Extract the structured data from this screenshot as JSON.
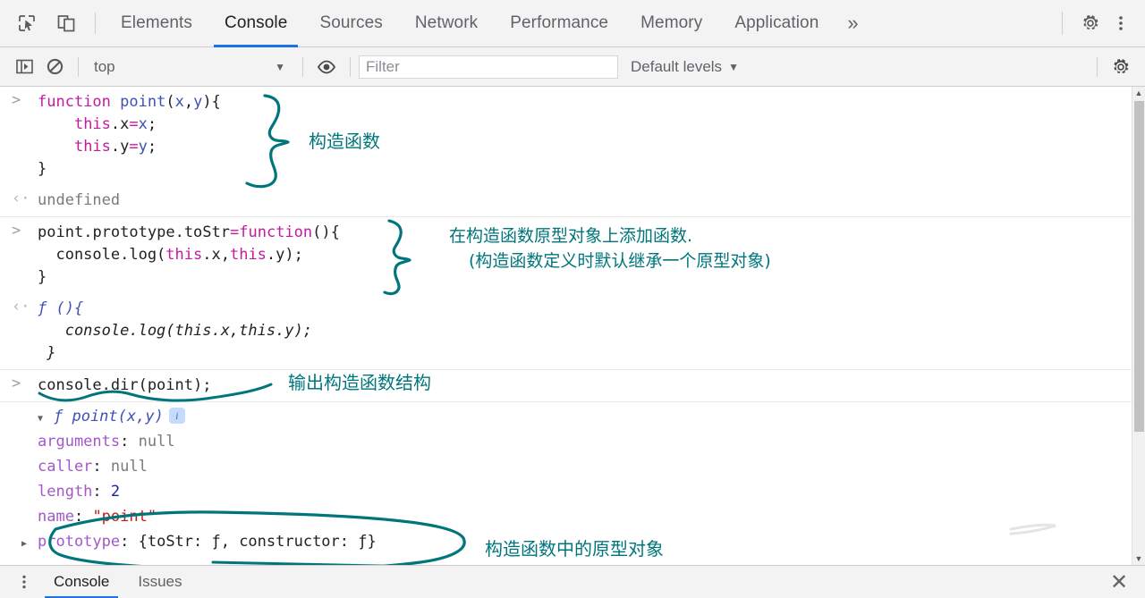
{
  "window": {
    "app": "Chrome DevTools"
  },
  "tabbar": {
    "icons": {
      "inspect": "inspect-element-icon",
      "device": "device-toolbar-icon",
      "more": "»",
      "settings": "gear-icon",
      "kebab": "more-options-icon"
    },
    "tabs": [
      {
        "label": "Elements",
        "active": false
      },
      {
        "label": "Console",
        "active": true
      },
      {
        "label": "Sources",
        "active": false
      },
      {
        "label": "Network",
        "active": false
      },
      {
        "label": "Performance",
        "active": false
      },
      {
        "label": "Memory",
        "active": false
      },
      {
        "label": "Application",
        "active": false
      }
    ]
  },
  "filterbar": {
    "sidebar_toggle": "show-console-sidebar-icon",
    "clear_console": "clear-console-icon",
    "context": "top",
    "context_caret": "▼",
    "eye": "live-expression-icon",
    "filter_placeholder": "Filter",
    "filter_value": "",
    "levels": "Default levels",
    "levels_caret": "▼",
    "settings": "gear-icon"
  },
  "console": {
    "prompt_glyph": ">",
    "response_glyph": "‹·",
    "entries": [
      {
        "id": "entry-function-point",
        "input_lines": [
          [
            {
              "t": "function ",
              "c": "kw"
            },
            {
              "t": "point",
              "c": "fn"
            },
            {
              "t": "(",
              "c": "plain"
            },
            {
              "t": "x",
              "c": "fn"
            },
            {
              "t": ",",
              "c": "plain"
            },
            {
              "t": "y",
              "c": "fn"
            },
            {
              "t": "){",
              "c": "plain"
            }
          ],
          [
            {
              "t": "    ",
              "c": "plain"
            },
            {
              "t": "this",
              "c": "kw"
            },
            {
              "t": ".",
              "c": "plain"
            },
            {
              "t": "x",
              "c": "plain"
            },
            {
              "t": "=",
              "c": "kw"
            },
            {
              "t": "x",
              "c": "fn"
            },
            {
              "t": ";",
              "c": "plain"
            }
          ],
          [
            {
              "t": "    ",
              "c": "plain"
            },
            {
              "t": "this",
              "c": "kw"
            },
            {
              "t": ".",
              "c": "plain"
            },
            {
              "t": "y",
              "c": "plain"
            },
            {
              "t": "=",
              "c": "kw"
            },
            {
              "t": "y",
              "c": "fn"
            },
            {
              "t": ";",
              "c": "plain"
            }
          ],
          [
            {
              "t": "}",
              "c": "plain"
            }
          ]
        ],
        "result": "undefined"
      },
      {
        "id": "entry-prototype-tostr",
        "input_lines": [
          [
            {
              "t": "point",
              "c": "plain"
            },
            {
              "t": ".",
              "c": "plain"
            },
            {
              "t": "prototype",
              "c": "plain"
            },
            {
              "t": ".",
              "c": "plain"
            },
            {
              "t": "toStr",
              "c": "plain"
            },
            {
              "t": "=",
              "c": "kw"
            },
            {
              "t": "function",
              "c": "kw"
            },
            {
              "t": "(){",
              "c": "plain"
            }
          ],
          [
            {
              "t": "  console.log(",
              "c": "plain"
            },
            {
              "t": "this",
              "c": "kw"
            },
            {
              "t": ".x,",
              "c": "plain"
            },
            {
              "t": "this",
              "c": "kw"
            },
            {
              "t": ".y);",
              "c": "plain"
            }
          ],
          [
            {
              "t": "}",
              "c": "plain"
            }
          ]
        ],
        "result_lines": [
          "ƒ (){",
          "   console.log(this.x,this.y);",
          " }"
        ]
      },
      {
        "id": "entry-console-dir",
        "input_text": "console.dir(point);",
        "object_header": "ƒ point(x,y)",
        "object_badge": "i",
        "properties": [
          {
            "name": "arguments",
            "sep": ": ",
            "value": "null",
            "vclass": "nul"
          },
          {
            "name": "caller",
            "sep": ": ",
            "value": "null",
            "vclass": "nul"
          },
          {
            "name": "length",
            "sep": ": ",
            "value": "2",
            "vclass": "num"
          },
          {
            "name": "name",
            "sep": ": ",
            "value": "\"point\"",
            "vclass": "str"
          }
        ],
        "prototype_row": {
          "name": "prototype",
          "sep": ": ",
          "value": "{toStr: ƒ, constructor: ƒ}"
        }
      }
    ]
  },
  "annotations": {
    "color": "#00767c",
    "items": [
      {
        "id": "anno-constructor",
        "text": "构造函数"
      },
      {
        "id": "anno-add-to-prototype-line1",
        "text": "在构造函数原型对象上添加函数."
      },
      {
        "id": "anno-add-to-prototype-line2",
        "text": "(构造函数定义时默认继承一个原型对象)"
      },
      {
        "id": "anno-output-structure",
        "text": "输出构造函数结构"
      },
      {
        "id": "anno-prototype-object",
        "text": "构造函数中的原型对象"
      }
    ]
  },
  "drawer": {
    "kebab": "drawer-more-options-icon",
    "tabs": [
      {
        "label": "Console",
        "active": true
      },
      {
        "label": "Issues",
        "active": false
      }
    ],
    "close": "✕"
  },
  "scrollbar": {
    "up": "▲",
    "down": "▼"
  }
}
